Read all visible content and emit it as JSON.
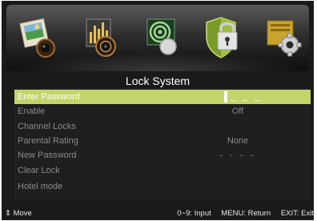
{
  "icons": [
    {
      "name": "picture-icon"
    },
    {
      "name": "sound-icon"
    },
    {
      "name": "channel-icon"
    },
    {
      "name": "lock-icon",
      "selected": true
    },
    {
      "name": "setup-icon"
    }
  ],
  "title": "Lock System",
  "menu": [
    {
      "label": "Enter Password",
      "value": "_ _ _",
      "selected": true
    },
    {
      "label": "Enable",
      "value": "Off"
    },
    {
      "label": "Channel Locks",
      "value": ""
    },
    {
      "label": "Parental Rating",
      "value": "None"
    },
    {
      "label": "New Password",
      "value": "- - - -"
    },
    {
      "label": "Clear Lock",
      "value": ""
    },
    {
      "label": "Hotel mode",
      "value": ""
    }
  ],
  "footer": {
    "move_glyph": "⇕",
    "move": "Move",
    "input": "0~9: Input",
    "return": "MENU: Return",
    "exit": "EXIT: Exit"
  },
  "colors": {
    "highlight": "#c3d56a",
    "menu_background": "#1f1f1f",
    "screen_background": "#1a1a1a"
  }
}
